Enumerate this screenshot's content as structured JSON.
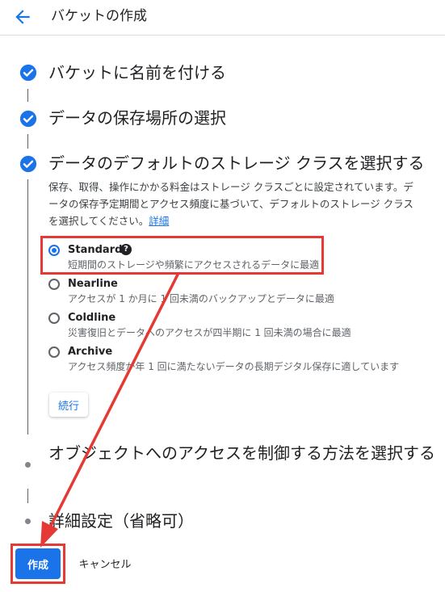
{
  "header": {
    "title": "バケットの作成",
    "back_icon": "arrow-back-icon"
  },
  "steps": [
    {
      "title": "バケットに名前を付ける",
      "status": "done"
    },
    {
      "title": "データの保存場所の選択",
      "status": "done"
    },
    {
      "title": "データのデフォルトのストレージ クラスを選択する",
      "status": "done"
    },
    {
      "title": "オブジェクトへのアクセスを制御する方法を選択する",
      "status": "pending"
    },
    {
      "title": "詳細設定（省略可）",
      "status": "pending"
    }
  ],
  "storage_class": {
    "description_lines": [
      "保存、取得、操作にかかる料金はストレージ クラスごとに設定されています。デ",
      "ータの保存予定期間とアクセス頻度に基づいて、デフォルトのストレージ クラス",
      "を選択してください。"
    ],
    "details_link": "詳細",
    "options": [
      {
        "label": "Standard",
        "description": "短期間のストレージや頻繁にアクセスされるデータに最適",
        "selected": true,
        "help_icon": "help-icon"
      },
      {
        "label": "Nearline",
        "description": "アクセスが 1 か月に 1 回未満のバックアップとデータに最適",
        "selected": false
      },
      {
        "label": "Coldline",
        "description": "災害復旧とデータへのアクセスが四半期に 1 回未満の場合に最適",
        "selected": false
      },
      {
        "label": "Archive",
        "description": "アクセス頻度が年 1 回に満たないデータの長期デジタル保存に適しています",
        "selected": false
      }
    ],
    "continue_label": "続行"
  },
  "footer": {
    "create_label": "作成",
    "cancel_label": "キャンセル"
  },
  "colors": {
    "accent": "#1a73e8",
    "annotation": "#e53935"
  }
}
